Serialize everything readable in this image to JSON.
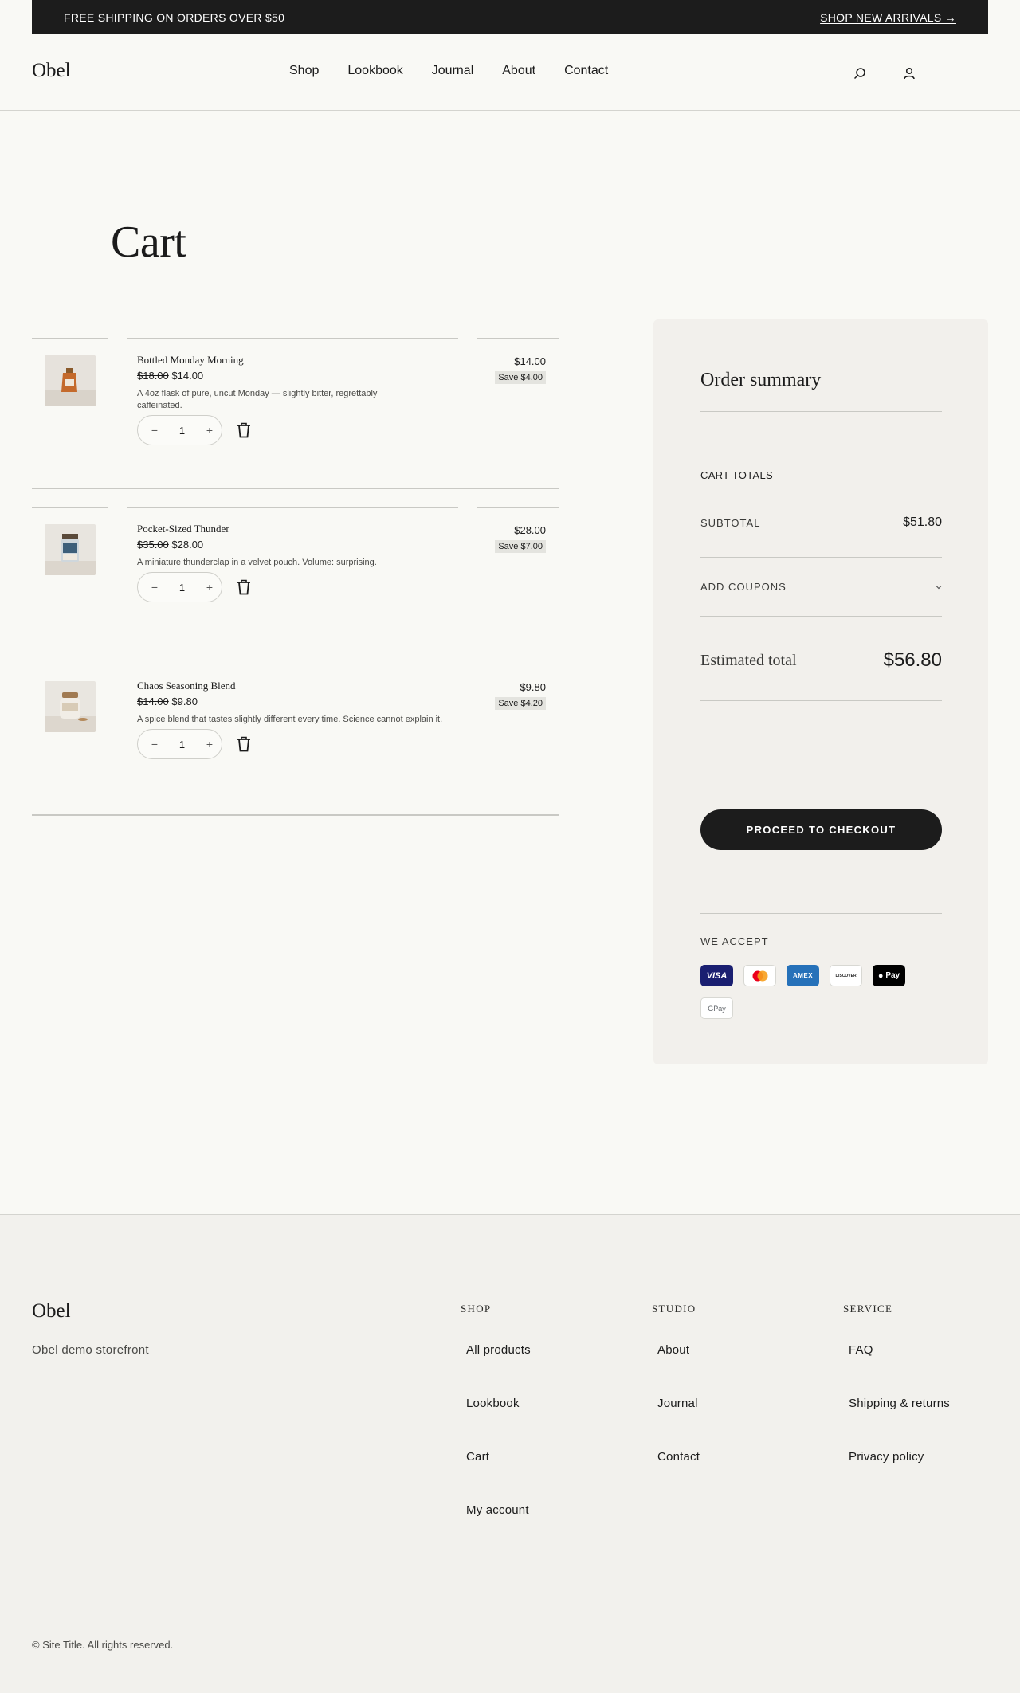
{
  "announcement": {
    "text": "FREE SHIPPING ON ORDERS OVER $50",
    "link": "SHOP NEW ARRIVALS →"
  },
  "header": {
    "logo": "Obel",
    "nav": [
      "Shop",
      "Lookbook",
      "Journal",
      "About",
      "Contact"
    ],
    "icons": [
      "search-icon",
      "account-icon"
    ]
  },
  "page": {
    "title": "Cart"
  },
  "cart": {
    "items": [
      {
        "name": "Bottled Monday Morning",
        "original_price": "$18.00",
        "price": "$14.00",
        "description": "A 4oz flask of pure, uncut Monday — slightly bitter, regrettably caffeinated.",
        "quantity": "1",
        "line_total": "$14.00",
        "savings": "Save $4.00"
      },
      {
        "name": "Pocket-Sized Thunder",
        "original_price": "$35.00",
        "price": "$28.00",
        "description": "A miniature thunderclap in a velvet pouch. Volume: surprising.",
        "quantity": "1",
        "line_total": "$28.00",
        "savings": "Save $7.00"
      },
      {
        "name": "Chaos Seasoning Blend",
        "original_price": "$14.00",
        "price": "$9.80",
        "description": "A spice blend that tastes slightly different every time. Science cannot explain it.",
        "quantity": "1",
        "line_total": "$9.80",
        "savings": "Save $4.20"
      }
    ],
    "qty_minus": "−",
    "qty_plus": "+"
  },
  "summary": {
    "title": "Order summary",
    "totals_heading": "CART TOTALS",
    "subtotal_label": "SUBTOTAL",
    "subtotal_value": "$51.80",
    "coupons_label": "ADD COUPONS",
    "estimated_label": "Estimated total",
    "estimated_value": "$56.80",
    "checkout_label": "PROCEED TO CHECKOUT",
    "accept_label": "WE ACCEPT",
    "payment_methods": [
      {
        "name": "VISA",
        "bg": "#1a1f71",
        "fg": "#ffffff"
      },
      {
        "name": "mastercard",
        "bg": "#ffffff",
        "fg": "#000000"
      },
      {
        "name": "AMEX",
        "bg": "#2671b9",
        "fg": "#ffffff"
      },
      {
        "name": "DISCOVER",
        "bg": "#ffffff",
        "fg": "#000000"
      },
      {
        "name": "Pay",
        "bg": "#000000",
        "fg": "#ffffff"
      },
      {
        "name": "GPay",
        "bg": "#ffffff",
        "fg": "#5f6368"
      }
    ]
  },
  "footer": {
    "logo": "Obel",
    "tagline": "Obel demo storefront",
    "columns": [
      {
        "heading": "SHOP",
        "links": [
          "All products",
          "Lookbook",
          "Cart",
          "My account"
        ]
      },
      {
        "heading": "STUDIO",
        "links": [
          "About",
          "Journal",
          "Contact"
        ]
      },
      {
        "heading": "SERVICE",
        "links": [
          "FAQ",
          "Shipping & returns",
          "Privacy policy"
        ]
      }
    ],
    "copyright": "© Site Title. All rights reserved."
  }
}
